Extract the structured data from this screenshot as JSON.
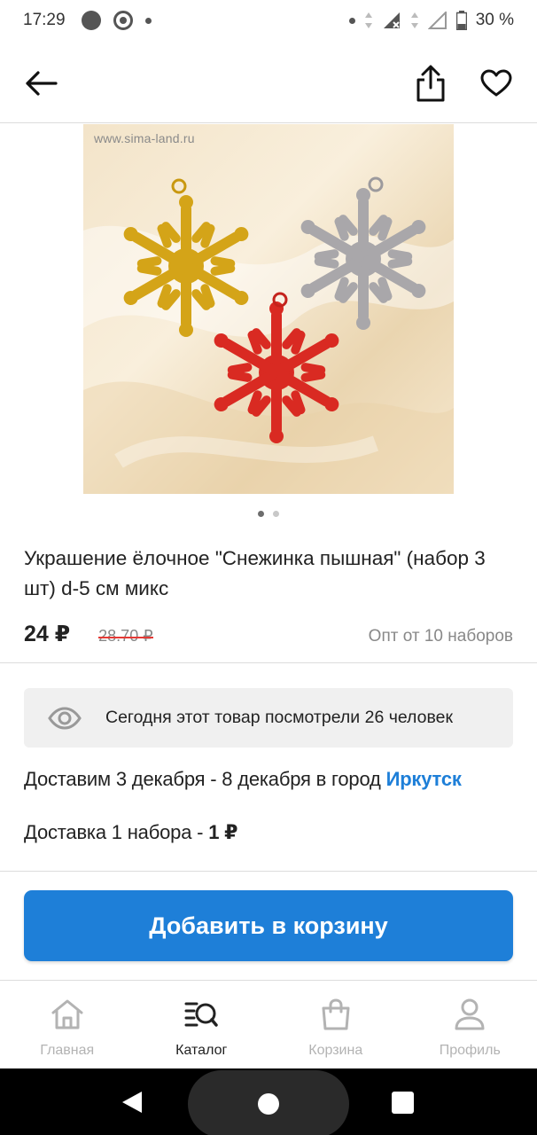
{
  "status_bar": {
    "time": "17:29",
    "battery": "30 %"
  },
  "app_bar": {
    "back_icon": "arrow-left-icon",
    "share_icon": "share-icon",
    "favorite_icon": "heart-outline-icon"
  },
  "product": {
    "image_watermark": "www.sima-land.ru",
    "image_count": 2,
    "active_image": 1,
    "title": "Украшение ёлочное \"Снежинка пышная\" (набор 3 шт) d-5 см микс",
    "price": "24 ₽",
    "old_price": "28.70 ₽",
    "wholesale": "Опт от 10 наборов"
  },
  "views": {
    "icon": "eye-icon",
    "text": "Сегодня этот товар посмотрели 26 человек"
  },
  "delivery": {
    "dates_text": "Доставим 3 декабря - 8 декабря в город ",
    "city": "Иркутск",
    "cost_label": "Доставка 1 набора  - ",
    "cost_value": "1 ₽"
  },
  "cart_button": {
    "label": "Добавить в корзину"
  },
  "bottom_nav": {
    "items": [
      {
        "label": "Главная",
        "icon": "home-icon",
        "active": false
      },
      {
        "label": "Каталог",
        "icon": "catalog-search-icon",
        "active": true
      },
      {
        "label": "Корзина",
        "icon": "shopping-bag-icon",
        "active": false
      },
      {
        "label": "Профиль",
        "icon": "profile-icon",
        "active": false
      }
    ]
  },
  "colors": {
    "accent": "#1e7fd8",
    "old_price_strike": "#e53935",
    "inactive_nav": "#b3b3b3"
  }
}
